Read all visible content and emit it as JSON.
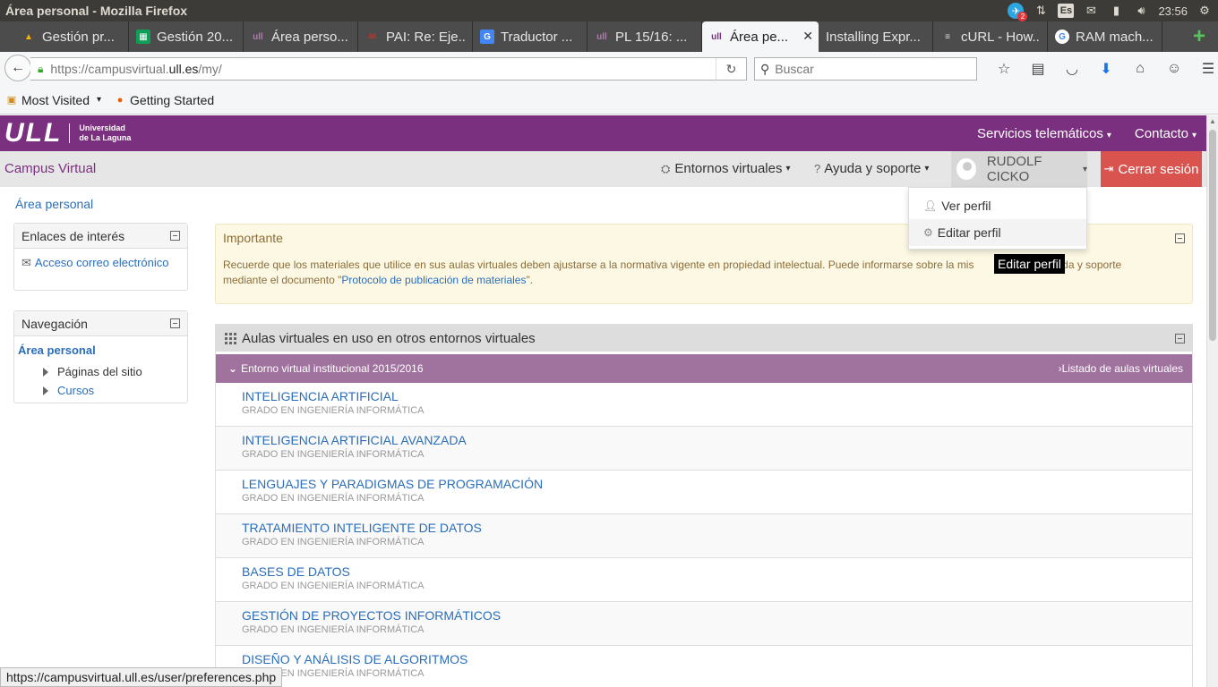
{
  "os": {
    "title": "Área personal - Mozilla Firefox",
    "keyboard": "Es",
    "telegram_count": "2",
    "clock": "23:56"
  },
  "tabs": [
    {
      "label": "Gestión pr...",
      "icon": "google-drive-icon"
    },
    {
      "label": "Gestión 20...",
      "icon": "google-sheets-icon"
    },
    {
      "label": "Área perso...",
      "icon": "ull-icon"
    },
    {
      "label": "PAI: Re: Eje...",
      "icon": "gmail-icon"
    },
    {
      "label": "Traductor ...",
      "icon": "google-translate-icon"
    },
    {
      "label": "PL 15/16: ...",
      "icon": "ull-icon"
    },
    {
      "label": "Área pe...",
      "icon": "ull-icon",
      "active": true
    },
    {
      "label": "Installing Expr...",
      "icon": "none"
    },
    {
      "label": "cURL - How...",
      "icon": "stackoverflow-icon"
    },
    {
      "label": "RAM mach...",
      "icon": "google-icon"
    }
  ],
  "urlbar": {
    "prefix": "https://campusvirtual.",
    "domain": "ull.es",
    "suffix": "/my/"
  },
  "search": {
    "placeholder": "Buscar"
  },
  "bookmarks": [
    {
      "label": "Most Visited"
    },
    {
      "label": "Getting Started"
    }
  ],
  "ull": {
    "logo": "ULL",
    "logo_line1": "Universidad",
    "logo_line2": "de La Laguna",
    "menu": [
      "Servicios telemáticos",
      "Contacto"
    ]
  },
  "campus": {
    "title": "Campus Virtual",
    "entornos": "Entornos virtuales",
    "ayuda": "Ayuda y soporte",
    "user": "RUDOLF CICKO",
    "logout": "Cerrar sesión"
  },
  "dropdown": {
    "items": [
      "Ver perfil",
      "Editar perfil"
    ],
    "tooltip": "Editar perfil"
  },
  "breadcrumb": "Área personal",
  "enlaces": {
    "title": "Enlaces de interés",
    "link": "Acceso correo electrónico"
  },
  "navegacion": {
    "title": "Navegación",
    "root": "Área personal",
    "items": [
      "Páginas del sitio",
      "Cursos"
    ]
  },
  "importante": {
    "title": "Importante",
    "text_before": "Recuerde que los materiales que utilice en sus aulas virtuales deben ajustarse a la normativa vigente en propiedad intelectual. Puede informarse sobre la mis",
    "text_after": "yuda y soporte mediante el documento \"",
    "link": "Protocolo de publicación de materiales",
    "text_end": "\"."
  },
  "aulas": {
    "title": "Aulas virtuales en uso en otros entornos virtuales",
    "entorno": "Entorno virtual institucional 2015/2016",
    "listado": "Listado de aulas virtuales",
    "courses": [
      {
        "name": "INTELIGENCIA ARTIFICIAL",
        "degree": "GRADO EN INGENIERÍA INFORMÁTICA"
      },
      {
        "name": "INTELIGENCIA ARTIFICIAL AVANZADA",
        "degree": "GRADO EN INGENIERÍA INFORMÁTICA"
      },
      {
        "name": "LENGUAJES Y PARADIGMAS DE PROGRAMACIÓN",
        "degree": "GRADO EN INGENIERÍA INFORMÁTICA"
      },
      {
        "name": "TRATAMIENTO INTELIGENTE DE DATOS",
        "degree": "GRADO EN INGENIERÍA INFORMÁTICA"
      },
      {
        "name": "BASES DE DATOS",
        "degree": "GRADO EN INGENIERÍA INFORMÁTICA"
      },
      {
        "name": "GESTIÓN DE PROYECTOS INFORMÁTICOS",
        "degree": "GRADO EN INGENIERÍA INFORMÁTICA"
      },
      {
        "name": "DISEÑO Y ANÁLISIS DE ALGORITMOS",
        "degree": "GRADO EN INGENIERÍA INFORMÁTICA"
      }
    ]
  },
  "status_url": "https://campusvirtual.ull.es/user/preferences.php"
}
